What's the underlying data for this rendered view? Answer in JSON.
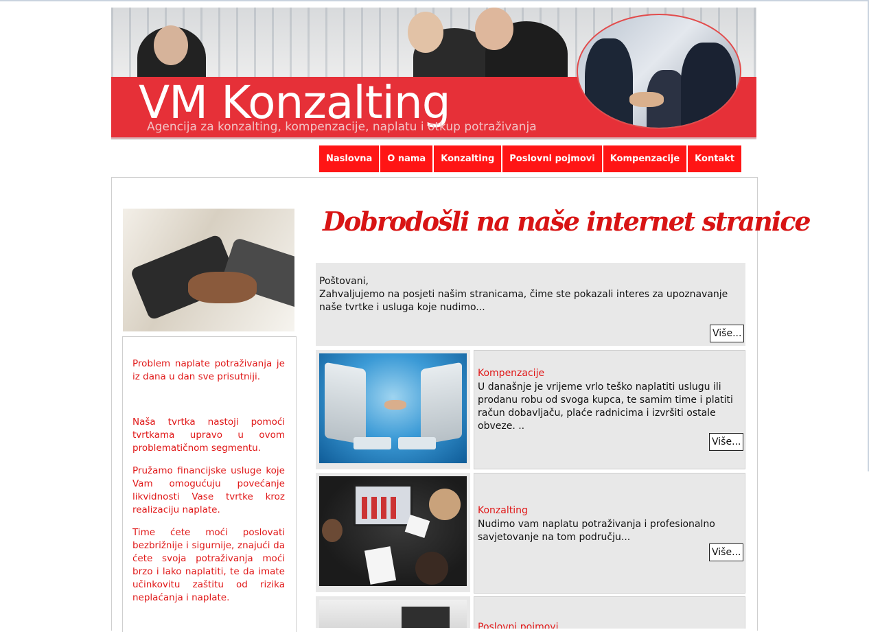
{
  "header": {
    "brand_title": "VM Konzalting",
    "brand_subtitle": "Agencija za konzalting, kompenzacije, naplatu i otkup potraživanja"
  },
  "nav": {
    "items": [
      {
        "label": "Naslovna"
      },
      {
        "label": "O nama"
      },
      {
        "label": "Konzalting"
      },
      {
        "label": "Poslovni pojmovi"
      },
      {
        "label": "Kompenzacije"
      },
      {
        "label": "Kontakt"
      }
    ]
  },
  "sidebar": {
    "paragraphs": [
      "Problem naplate potraživanja je iz dana u dan sve prisutniji.",
      "Naša tvrtka nastoji pomoći tvrtkama upravo u ovom problematičnom segmentu.",
      "Pružamo financijske usluge koje Vam omogućuju povećanje likvidnosti Vase tvrtke kroz realizaciju naplate.",
      "Time ćete moći poslovati bezbrižnije i sigurnije, znajući da ćete svoja potraživanja moći brzo i lako naplatiti, te da imate učinkovitu zaštitu od rizika neplaćanja i naplate."
    ]
  },
  "main": {
    "welcome_heading": "Dobrodošli na naše internet stranice",
    "intro": {
      "greeting": "Poštovani,",
      "text": "Zahvaljujemo na posjeti našim stranicama, čime ste pokazali interes za upoznavanje naše tvrtke i usluga koje nudimo...",
      "more_label": "Više..."
    },
    "cards": [
      {
        "title": "Kompenzacije",
        "text": "U današnje je vrijeme vrlo teško naplatiti uslugu ili prodanu robu od svoga kupca, te samim time i platiti račun dobavljaču, plaće radnicima i izvršiti ostale obveze. ..",
        "more_label": "Više..."
      },
      {
        "title": "Konzalting",
        "text": "Nudimo vam naplatu potraživanja i profesionalno savjetovanje na tom području...",
        "more_label": "Više..."
      },
      {
        "title": "Poslovni pojmovi"
      }
    ]
  },
  "colors": {
    "brand_red": "#ff1515",
    "text_red": "#e01818",
    "panel_gray": "#e8e8e8"
  }
}
